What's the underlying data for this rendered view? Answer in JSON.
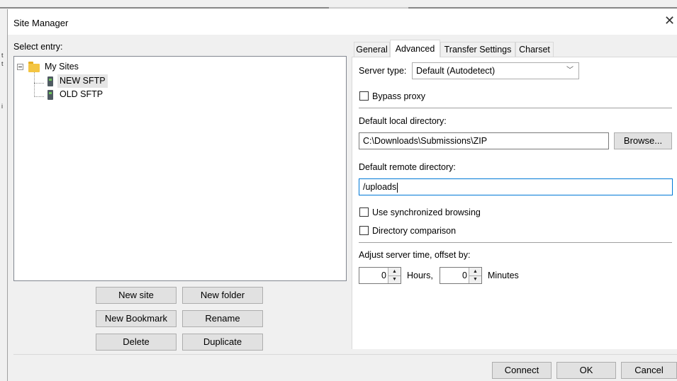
{
  "window": {
    "title": "Site Manager",
    "close_glyph": "✕"
  },
  "side_marks": [
    "t",
    "t",
    "i"
  ],
  "left": {
    "select_label": "Select entry:",
    "tree": {
      "root": {
        "label": "My Sites",
        "icon": "folder-icon",
        "expander": "minus"
      },
      "children": [
        {
          "label": "NEW SFTP",
          "icon": "server-icon",
          "selected": true
        },
        {
          "label": "OLD SFTP",
          "icon": "server-icon",
          "selected": false
        }
      ]
    },
    "buttons": {
      "new_site": "New site",
      "new_folder": "New folder",
      "new_bookmark": "New Bookmark",
      "rename": "Rename",
      "delete": "Delete",
      "duplicate": "Duplicate"
    }
  },
  "tabs": [
    {
      "label": "General",
      "active": false
    },
    {
      "label": "Advanced",
      "active": true
    },
    {
      "label": "Transfer Settings",
      "active": false
    },
    {
      "label": "Charset",
      "active": false
    }
  ],
  "advanced": {
    "server_type_label": "Server type:",
    "server_type_value": "Default (Autodetect)",
    "bypass_proxy_label": "Bypass proxy",
    "bypass_proxy_checked": false,
    "local_dir_label": "Default local directory:",
    "local_dir_value": "C:\\Downloads\\Submissions\\ZIP",
    "browse_label": "Browse...",
    "remote_dir_label": "Default remote directory:",
    "remote_dir_value": "/uploads",
    "sync_browsing_label": "Use synchronized browsing",
    "sync_browsing_checked": false,
    "dir_compare_label": "Directory comparison",
    "dir_compare_checked": false,
    "offset_label": "Adjust server time, offset by:",
    "hours_value": "0",
    "hours_label": "Hours,",
    "minutes_value": "0",
    "minutes_label": "Minutes"
  },
  "footer": {
    "connect": "Connect",
    "ok": "OK",
    "cancel": "Cancel"
  }
}
